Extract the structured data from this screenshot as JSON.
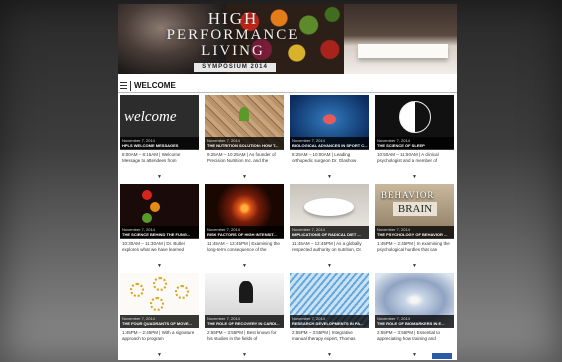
{
  "banner": {
    "title_line1": "HIGH",
    "title_line2": "PERFORMANCE",
    "title_line3": "LIVING",
    "subtitle": "SYMPOSIUM 2014"
  },
  "nav": {
    "section_title": "WELCOME"
  },
  "cards": [
    {
      "thumb_text": "welcome",
      "date": "November 7, 2014",
      "title": "HPLS WELCOME MESSAGES",
      "desc": "8:00AM – 8:15AM | Welcome Message to attendees from"
    },
    {
      "date": "November 7, 2014",
      "title": "THE NUTRITION SOLUTION: HOW T...",
      "desc": "9:25AM – 10:25AM | As founder of Precision Nutrition Inc. and the"
    },
    {
      "date": "November 7, 2014",
      "title": "BIOLOGICAL ADVANCES IN SPORT C...",
      "desc": "8:25AM – 10:00AM | Leading orthopedic surgeon Dr. Glashow"
    },
    {
      "date": "November 7, 2014",
      "title": "THE SCIENCE OF SLEEP",
      "desc": "10:50AM – 11:50AM | A clinical psychologist and a member of"
    },
    {
      "date": "November 7, 2014",
      "title": "THE SCIENCE BEHIND THE FUNG...",
      "desc": "10:30AM – 11:30AM | Dr. Butler explores what we have learned"
    },
    {
      "date": "November 7, 2014",
      "title": "RISK FACTORS OF HIGH INTENSIT...",
      "desc": "11:45AM – 12:45PM | Examining the long-term consequence of the"
    },
    {
      "date": "November 7, 2014",
      "title": "IMPLICATIONS OF RADICAL DIET ...",
      "desc": "11:45AM – 12:45PM | As a globally respected authority on nutrition, Dr."
    },
    {
      "thumb_word1": "BEHAVIOR",
      "thumb_word2": "BRAIN",
      "date": "November 7, 2014",
      "title": "THE PSYCHOLOGY OF BEHAVIOR ...",
      "desc": "1:45PM – 2:45PM | In examining the psychological hurdles that can"
    },
    {
      "date": "November 7, 2014",
      "title": "THE FOUR QUADRANTS OF MOVE...",
      "desc": "1:45PM – 2:45PM | With a signature approach to program"
    },
    {
      "date": "November 7, 2014",
      "title": "THE ROLE OF RECOVERY IN CARDI...",
      "desc": "2:55PM – 3:55PM | Best known for his studies in the fields of"
    },
    {
      "date": "November 7, 2014",
      "title": "RESEARCH DEVELOPMENTS IN PA...",
      "desc": "2:55PM – 3:55PM | Integrative manual therapy expert, Thomas"
    },
    {
      "date": "November 7, 2014",
      "title": "THE ROLE OF BIOMARKERS IN E...",
      "desc": "2:55PM – 3:55PM | Essential to appreciating how training and"
    }
  ]
}
